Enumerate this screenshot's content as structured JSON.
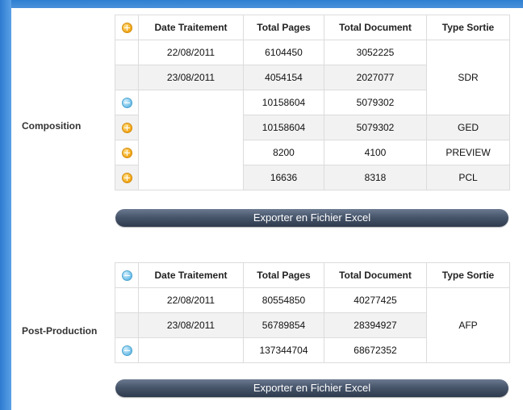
{
  "composition": {
    "label": "Composition",
    "headers": [
      "Date Traitement",
      "Total Pages",
      "Total Document",
      "Type Sortie"
    ],
    "rows": [
      {
        "date": "22/08/2011",
        "pages": "6104450",
        "docs": "3052225"
      },
      {
        "date": "23/08/2011",
        "pages": "4054154",
        "docs": "2027077"
      },
      {
        "date": "",
        "pages": "10158604",
        "docs": "5079302"
      },
      {
        "date": "",
        "pages": "10158604",
        "docs": "5079302",
        "type": "GED"
      },
      {
        "date": "",
        "pages": "8200",
        "docs": "4100",
        "type": "PREVIEW"
      },
      {
        "date": "",
        "pages": "16636",
        "docs": "8318",
        "type": "PCL"
      }
    ],
    "sdr_type": "SDR",
    "export_label": "Exporter en Fichier Excel"
  },
  "post_production": {
    "label": "Post-Production",
    "headers": [
      "Date Traitement",
      "Total Pages",
      "Total Document",
      "Type Sortie"
    ],
    "rows": [
      {
        "date": "22/08/2011",
        "pages": "80554850",
        "docs": "40277425"
      },
      {
        "date": "23/08/2011",
        "pages": "56789854",
        "docs": "28394927"
      },
      {
        "date": "",
        "pages": "137344704",
        "docs": "68672352"
      }
    ],
    "afp_type": "AFP",
    "export_label": "Exporter en Fichier Excel"
  }
}
